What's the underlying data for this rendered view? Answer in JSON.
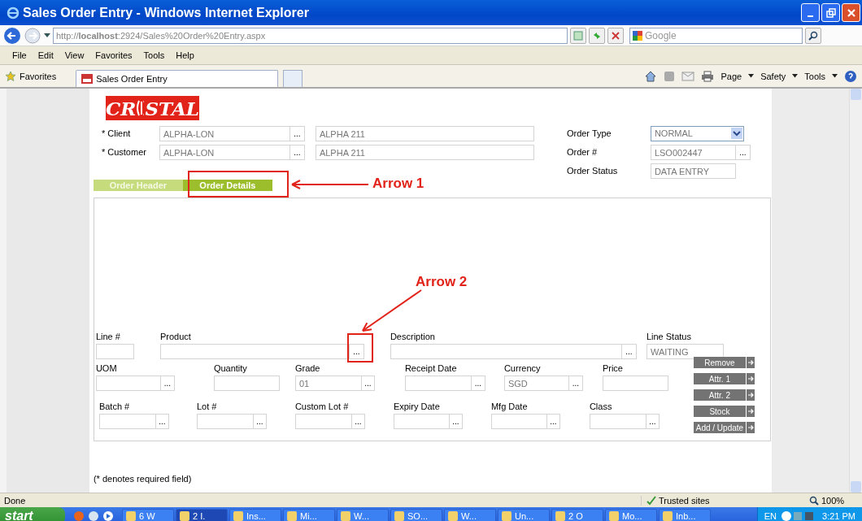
{
  "window": {
    "title": "Sales Order Entry - Windows Internet Explorer"
  },
  "address_bar": {
    "url": "http://**localhost**:2924/Sales%20Order%20Entry.aspx"
  },
  "search": {
    "placeholder": "Google"
  },
  "menu": [
    "File",
    "Edit",
    "View",
    "Favorites",
    "Tools",
    "Help"
  ],
  "favorites_bar": {
    "label": "Favorites",
    "tabs": [
      {
        "label": "Sales Order Entry",
        "selected": true
      }
    ]
  },
  "command_bar": [
    "Page",
    "Safety",
    "Tools"
  ],
  "logo": {
    "parts": [
      "CR",
      "STAL"
    ]
  },
  "header": {
    "left": [
      {
        "label": "* Client",
        "code": "ALPHA-LON",
        "button": "...",
        "name": "ALPHA 211"
      },
      {
        "label": "* Customer",
        "code": "ALPHA-LON",
        "button": "...",
        "name": "ALPHA 211"
      }
    ],
    "right": [
      {
        "label": "Order Type",
        "value": "NORMAL",
        "kind": "select"
      },
      {
        "label": "Order #",
        "value": "LSO002447",
        "kind": "lookup",
        "button": "..."
      },
      {
        "label": "Order Status",
        "value": "DATA ENTRY",
        "kind": "text"
      }
    ]
  },
  "tabs": [
    {
      "label": "Order Header",
      "selected": false
    },
    {
      "label": "Order Details",
      "selected": true
    }
  ],
  "detail_rows": [
    [
      {
        "label": "Line #"
      },
      {
        "label": "Product",
        "button": "..."
      },
      {
        "label": "Description",
        "button": "..."
      },
      {
        "label": "Line Status",
        "value": "WAITING"
      }
    ],
    [
      {
        "label": "UOM",
        "button": "..."
      },
      {
        "label": "Quantity"
      },
      {
        "label": "Grade",
        "value": "01",
        "button": "..."
      },
      {
        "label": "Receipt Date",
        "button": "..."
      },
      {
        "label": "Currency",
        "value": "SGD",
        "button": "..."
      },
      {
        "label": "Price"
      }
    ],
    [
      {
        "label": "Batch #",
        "button": "..."
      },
      {
        "label": "Lot #",
        "button": "..."
      },
      {
        "label": "Custom Lot #",
        "button": "..."
      },
      {
        "label": "Expiry Date",
        "button": "..."
      },
      {
        "label": "Mfg Date",
        "button": "..."
      },
      {
        "label": "Class",
        "button": "..."
      }
    ]
  ],
  "buttons": [
    "Remove",
    "Attr. 1",
    "Attr. 2",
    "Stock",
    "Add / Update"
  ],
  "note": "(* denotes required field)",
  "annotations": [
    {
      "kind": "arrow",
      "label": "Arrow 1"
    },
    {
      "kind": "arrow",
      "label": "Arrow 2"
    }
  ],
  "status_bar": {
    "text": "Done",
    "zone": "Trusted sites",
    "zoom": "100%"
  },
  "taskbar": {
    "start": "start",
    "buttons": [
      {
        "label": "6 W",
        "selected": false
      },
      {
        "label": "2 I.",
        "selected": true
      },
      {
        "label": "Ins...",
        "selected": false
      },
      {
        "label": "Mi...",
        "selected": false
      },
      {
        "label": "W...",
        "selected": false
      },
      {
        "label": "SO...",
        "selected": false
      },
      {
        "label": "W...",
        "selected": false
      },
      {
        "label": "Un...",
        "selected": false
      },
      {
        "label": "2 O",
        "selected": false
      },
      {
        "label": "Mo...",
        "selected": false
      },
      {
        "label": "Inb...",
        "selected": false
      }
    ],
    "language": "EN",
    "clock": "3:21 PM"
  }
}
